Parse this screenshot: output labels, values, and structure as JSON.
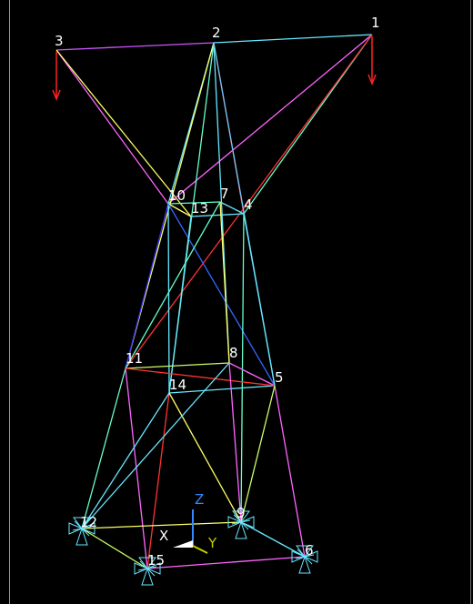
{
  "model": {
    "nodes": [
      {
        "id": "1",
        "label": "1"
      },
      {
        "id": "2",
        "label": "2"
      },
      {
        "id": "3",
        "label": "3"
      },
      {
        "id": "4",
        "label": "4"
      },
      {
        "id": "5",
        "label": "5"
      },
      {
        "id": "6",
        "label": "6"
      },
      {
        "id": "7",
        "label": "7"
      },
      {
        "id": "8",
        "label": "8"
      },
      {
        "id": "9",
        "label": "9"
      },
      {
        "id": "10",
        "label": "10"
      },
      {
        "id": "11",
        "label": "11"
      },
      {
        "id": "12",
        "label": "12"
      },
      {
        "id": "13",
        "label": "13"
      },
      {
        "id": "14",
        "label": "14"
      },
      {
        "id": "15",
        "label": "15"
      }
    ],
    "elements": [
      {
        "a": "3",
        "b": "2",
        "color": "#cc55ff"
      },
      {
        "a": "2",
        "b": "1",
        "color": "#66e8ff"
      },
      {
        "a": "3",
        "b": "10",
        "color": "#ff66ff"
      },
      {
        "a": "3",
        "b": "13",
        "color": "#ffff66"
      },
      {
        "a": "1",
        "b": "4",
        "color": "#66ffcc"
      },
      {
        "a": "1",
        "b": "10",
        "color": "#ff66ff"
      },
      {
        "a": "1",
        "b": "11",
        "color": "#ff3333"
      },
      {
        "a": "2",
        "b": "10",
        "color": "#66e8ff"
      },
      {
        "a": "2",
        "b": "4",
        "color": "#ff2222"
      },
      {
        "a": "2",
        "b": "11",
        "color": "#ffff66"
      },
      {
        "a": "2",
        "b": "14",
        "color": "#66ffcc"
      },
      {
        "a": "2",
        "b": "8",
        "color": "#66e8ff"
      },
      {
        "a": "2",
        "b": "5",
        "color": "#66ccff"
      },
      {
        "a": "10",
        "b": "7",
        "color": "#66ffcc"
      },
      {
        "a": "7",
        "b": "4",
        "color": "#66e8ff"
      },
      {
        "a": "13",
        "b": "4",
        "color": "#66e8ff"
      },
      {
        "a": "10",
        "b": "13",
        "color": "#ffff66"
      },
      {
        "a": "10",
        "b": "11",
        "color": "#3333ff"
      },
      {
        "a": "10",
        "b": "14",
        "color": "#66e8ff"
      },
      {
        "a": "10",
        "b": "5",
        "color": "#3366ff"
      },
      {
        "a": "7",
        "b": "8",
        "color": "#ffff66"
      },
      {
        "a": "7",
        "b": "11",
        "color": "#66ffcc"
      },
      {
        "a": "4",
        "b": "5",
        "color": "#66e8ff"
      },
      {
        "a": "4",
        "b": "9",
        "color": "#66ffcc"
      },
      {
        "a": "13",
        "b": "14",
        "color": "#66e8ff"
      },
      {
        "a": "11",
        "b": "8",
        "color": "#ccff66"
      },
      {
        "a": "8",
        "b": "5",
        "color": "#ff66ff"
      },
      {
        "a": "14",
        "b": "5",
        "color": "#66e8ff"
      },
      {
        "a": "11",
        "b": "12",
        "color": "#66ffcc"
      },
      {
        "a": "11",
        "b": "15",
        "color": "#ff66ff"
      },
      {
        "a": "11",
        "b": "5",
        "color": "#ff3333"
      },
      {
        "a": "14",
        "b": "15",
        "color": "#ff3333"
      },
      {
        "a": "14",
        "b": "12",
        "color": "#66e8ff"
      },
      {
        "a": "14",
        "b": "9",
        "color": "#ffff66"
      },
      {
        "a": "8",
        "b": "9",
        "color": "#ff66ff"
      },
      {
        "a": "8",
        "b": "12",
        "color": "#66e8ff"
      },
      {
        "a": "5",
        "b": "6",
        "color": "#ff66ff"
      },
      {
        "a": "5",
        "b": "9",
        "color": "#ccff66"
      },
      {
        "a": "12",
        "b": "9",
        "color": "#ffff66"
      },
      {
        "a": "12",
        "b": "15",
        "color": "#ccff66"
      },
      {
        "a": "15",
        "b": "6",
        "color": "#ff66ff"
      },
      {
        "a": "9",
        "b": "6",
        "color": "#66e8ff"
      }
    ],
    "loads": [
      {
        "node": "3",
        "color": "#ff2222"
      },
      {
        "node": "1",
        "color": "#ff2222"
      }
    ],
    "supports": [
      "12",
      "15",
      "9",
      "6"
    ],
    "triad": {
      "z_label": "Z",
      "x_label": "X",
      "y_label": "Y",
      "z_color": "#3388ff",
      "x_color": "#ffffff",
      "y_color": "#cccc00"
    },
    "colors": {
      "background": "#000000",
      "node_label": "#ffffff",
      "support": "#66e8ff"
    }
  }
}
